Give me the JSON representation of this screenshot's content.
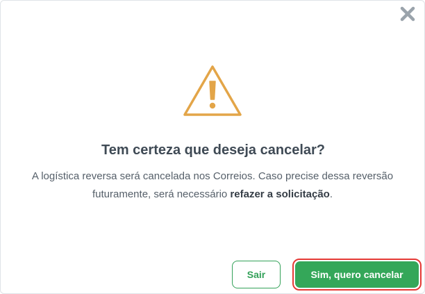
{
  "dialog": {
    "close_icon": "close-icon",
    "warning_icon": "warning-triangle-icon",
    "title": "Tem certeza que deseja cancelar?",
    "message_part1": "A logística reversa será cancelada nos Correios. Caso precise dessa reversão futuramente, será necessário ",
    "message_bold": "refazer a solicitação",
    "message_end": ".",
    "cancel_button_label": "Sair",
    "confirm_button_label": "Sim, quero cancelar"
  },
  "colors": {
    "warning": "#e3a548",
    "title": "#3f4a55",
    "body_text": "#555f69",
    "primary_green": "#34a759",
    "highlight_outline": "#e53935",
    "close_icon": "#9aa3ab"
  }
}
